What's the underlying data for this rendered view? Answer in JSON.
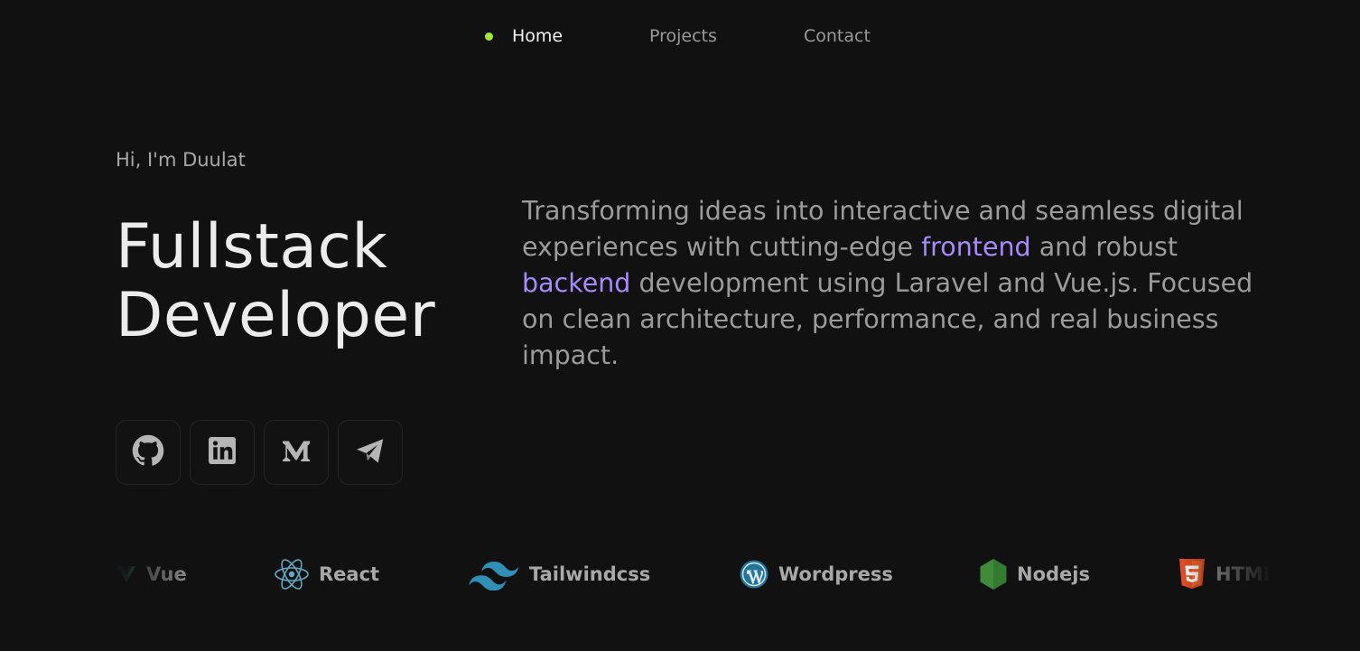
{
  "nav": {
    "active_dot_color": "#a3e635",
    "items": [
      {
        "label": "Home",
        "active": true
      },
      {
        "label": "Projects",
        "active": false
      },
      {
        "label": "Contact",
        "active": false
      }
    ]
  },
  "hero": {
    "greeting": "Hi, I'm Duulat",
    "title_line1": "Fullstack",
    "title_line2": "Developer",
    "description": {
      "part1": "Transforming ideas into interactive and seamless digital experiences with cutting-edge ",
      "highlight1": "frontend",
      "part2": " and robust ",
      "highlight2": "backend",
      "part3": " development using Laravel and Vue.js. Focused on clean architecture, performance, and real business impact.",
      "highlight_color": "#a78bfa"
    }
  },
  "social": [
    {
      "name": "GitHub",
      "icon": "github-icon"
    },
    {
      "name": "LinkedIn",
      "icon": "linkedin-icon"
    },
    {
      "name": "Medium",
      "icon": "medium-icon"
    },
    {
      "name": "Telegram",
      "icon": "telegram-icon"
    }
  ],
  "tech_stack": [
    {
      "label": "Vue",
      "icon": "vue-icon"
    },
    {
      "label": "React",
      "icon": "react-icon"
    },
    {
      "label": "Tailwindcss",
      "icon": "tailwindcss-icon"
    },
    {
      "label": "Wordpress",
      "icon": "wordpress-icon"
    },
    {
      "label": "Nodejs",
      "icon": "nodejs-icon"
    },
    {
      "label": "HTML",
      "icon": "html5-icon"
    }
  ]
}
